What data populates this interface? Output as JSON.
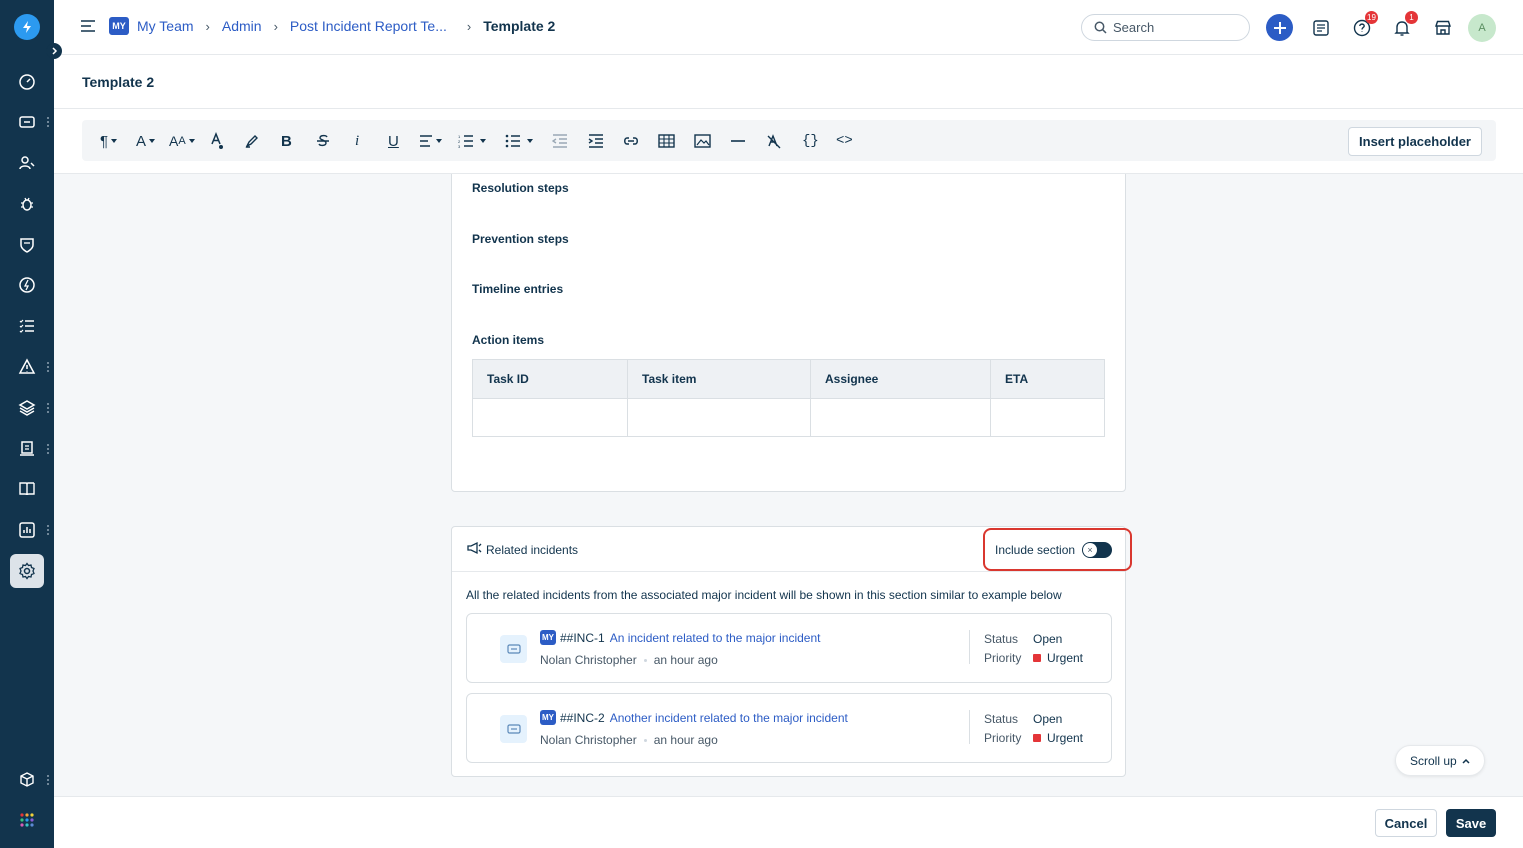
{
  "header": {
    "workspace_badge": "MY",
    "breadcrumbs": [
      "My Team",
      "Admin",
      "Post Incident Report Te..."
    ],
    "current": "Template 2",
    "search_placeholder": "Search",
    "help_badge": "19",
    "notification_badge": "1",
    "avatar_initial": "A"
  },
  "page": {
    "title": "Template 2"
  },
  "toolbar": {
    "insert_placeholder_label": "Insert placeholder"
  },
  "editor": {
    "sections": [
      "Resolution steps",
      "Prevention steps",
      "Timeline entries",
      "Action items"
    ],
    "action_table": {
      "columns": [
        "Task ID",
        "Task item",
        "Assignee",
        "ETA"
      ]
    }
  },
  "related": {
    "title": "Related incidents",
    "include_label": "Include section",
    "include_enabled": false,
    "description": "All the related incidents from the associated major incident will be shown in this section similar to example below",
    "status_label": "Status",
    "priority_label": "Priority",
    "incidents": [
      {
        "badge": "MY",
        "id": "##INC-1",
        "subject": "An incident related to the major incident",
        "requester": "Nolan Christopher",
        "time": "an hour ago",
        "status": "Open",
        "priority": "Urgent"
      },
      {
        "badge": "MY",
        "id": "##INC-2",
        "subject": "Another incident related to the major incident",
        "requester": "Nolan Christopher",
        "time": "an hour ago",
        "status": "Open",
        "priority": "Urgent"
      }
    ]
  },
  "scroll_up_label": "Scroll up",
  "footer": {
    "cancel_label": "Cancel",
    "save_label": "Save"
  },
  "colors": {
    "nav": "#12344d",
    "accent": "#2c5cc5",
    "highlight": "#d9372f",
    "urgent": "#e43538"
  }
}
